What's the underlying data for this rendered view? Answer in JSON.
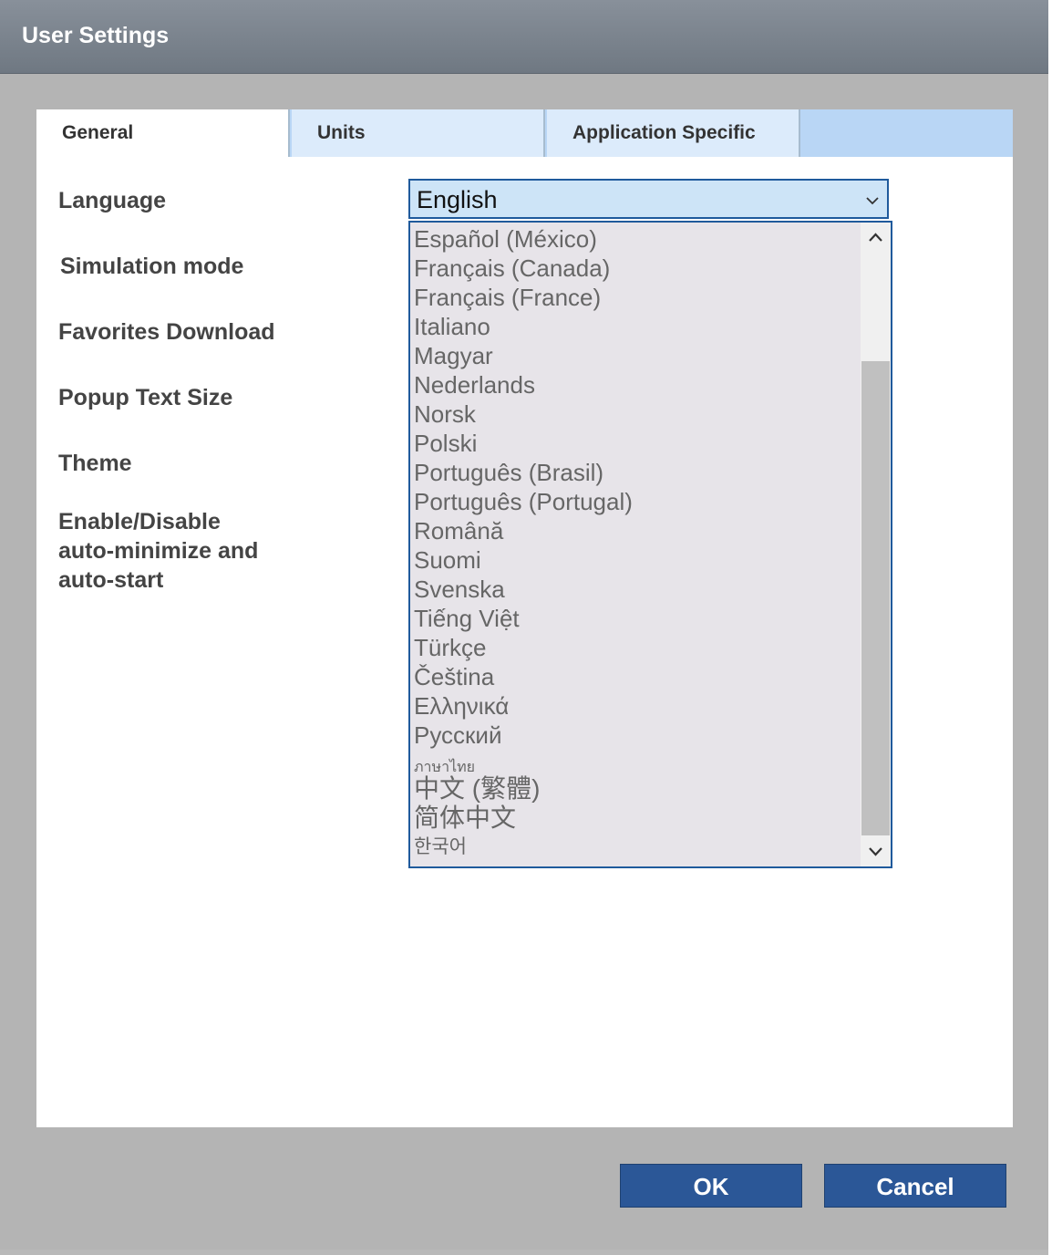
{
  "window": {
    "title": "User Settings"
  },
  "tabs": [
    {
      "label": "General",
      "active": true
    },
    {
      "label": "Units",
      "active": false
    },
    {
      "label": "Application Specific",
      "active": false
    }
  ],
  "settings_labels": {
    "language": "Language",
    "simulation_mode": "Simulation mode",
    "favorites_download": "Favorites Download",
    "popup_text_size": "Popup Text Size",
    "theme": "Theme",
    "auto_min_line1": "Enable/Disable",
    "auto_min_line2": "auto-minimize and",
    "auto_min_line3": "auto-start"
  },
  "language_select": {
    "selected": "English",
    "options": [
      "Español (México)",
      "Français (Canada)",
      "Français (France)",
      "Italiano",
      "Magyar",
      "Nederlands",
      "Norsk",
      "Polski",
      "Português (Brasil)",
      "Português (Portugal)",
      "Română",
      "Suomi",
      "Svenska",
      "Tiếng Việt",
      "Türkçe",
      "Čeština",
      "Ελληνικά",
      "Русский",
      "ภาษาไทย",
      "中文 (繁體)",
      "简体中文",
      "한국어"
    ]
  },
  "buttons": {
    "ok": "OK",
    "cancel": "Cancel"
  },
  "colors": {
    "accent": "#2b5797",
    "select_border": "#1f5a9c"
  }
}
